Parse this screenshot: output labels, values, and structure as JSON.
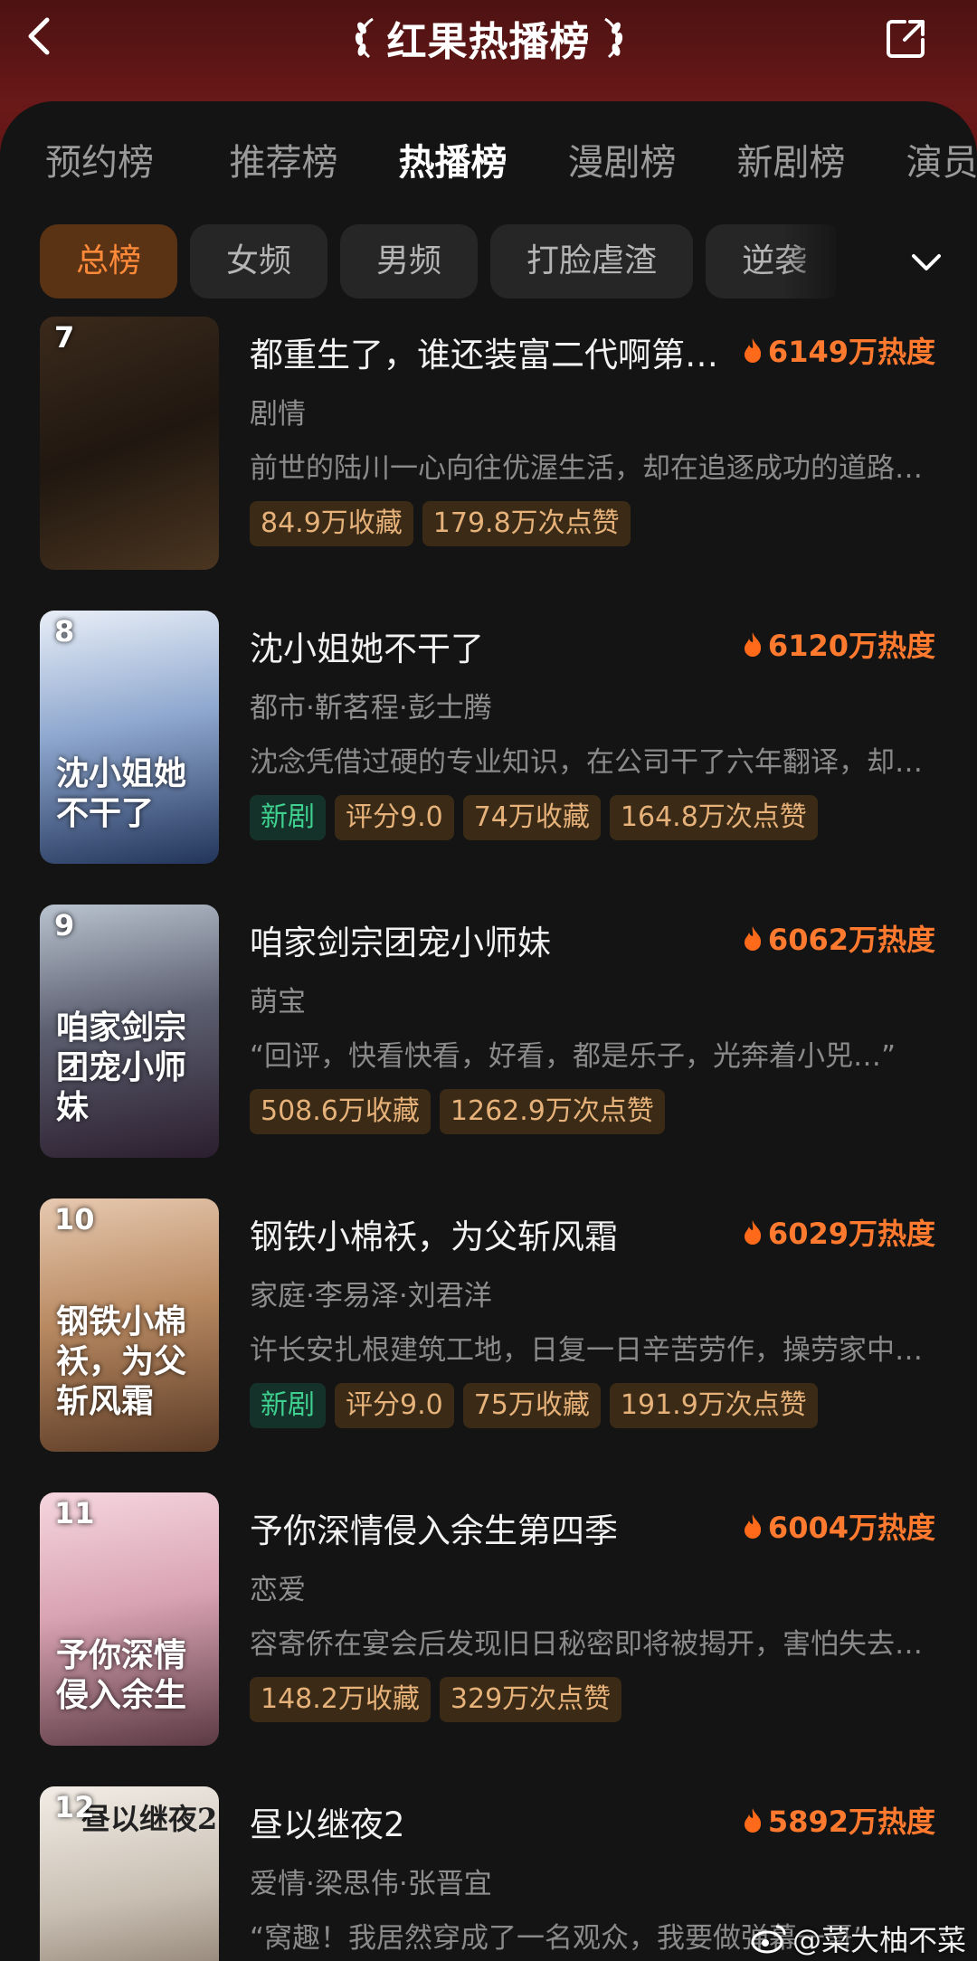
{
  "header": {
    "title": "红果热播榜"
  },
  "main_tabs": [
    {
      "label": "预约榜"
    },
    {
      "label": "推荐榜"
    },
    {
      "label": "热播榜",
      "active": true
    },
    {
      "label": "漫剧榜"
    },
    {
      "label": "新剧榜"
    },
    {
      "label": "演员榜"
    }
  ],
  "sub_tabs": [
    {
      "label": "总榜",
      "active": true
    },
    {
      "label": "女频"
    },
    {
      "label": "男频"
    },
    {
      "label": "打脸虐渣"
    },
    {
      "label": "逆袭"
    }
  ],
  "items": [
    {
      "rank": "7",
      "title": "都重生了，谁还装富二代啊第三季",
      "heat": "6149万热度",
      "meta": "剧情",
      "desc": "前世的陆川一心向往优渥生活，却在追逐成功的道路上迷失了自我",
      "tags": [
        {
          "text": "84.9万收藏"
        },
        {
          "text": "179.8万次点赞"
        }
      ],
      "cover_text": ""
    },
    {
      "rank": "8",
      "title": "沈小姐她不干了",
      "heat": "6120万热度",
      "meta": "都市·靳茗程·彭士腾",
      "desc": "沈念凭借过硬的专业知识，在公司干了六年翻译，却被上司抢走功劳",
      "tags": [
        {
          "text": "新剧",
          "green": true
        },
        {
          "text": "评分9.0"
        },
        {
          "text": "74万收藏"
        },
        {
          "text": "164.8万次点赞"
        }
      ],
      "cover_text": "沈小姐她不干了"
    },
    {
      "rank": "9",
      "title": "咱家剑宗团宠小师妹",
      "heat": "6062万热度",
      "meta": "萌宝",
      "desc": "“回评，快看快看，好看，都是乐子，光奔着小兕…”",
      "tags": [
        {
          "text": "508.6万收藏"
        },
        {
          "text": "1262.9万次点赞"
        }
      ],
      "cover_text": "咱家剑宗团宠小师妹"
    },
    {
      "rank": "10",
      "title": "钢铁小棉袄，为父斩风霜",
      "heat": "6029万热度",
      "meta": "家庭·李易泽·刘君洋",
      "desc": "许长安扎根建筑工地，日复一日辛苦劳作，操劳家中大小事务",
      "tags": [
        {
          "text": "新剧",
          "green": true
        },
        {
          "text": "评分9.0"
        },
        {
          "text": "75万收藏"
        },
        {
          "text": "191.9万次点赞"
        }
      ],
      "cover_text": "钢铁小棉袄，为父斩风霜"
    },
    {
      "rank": "11",
      "title": "予你深情侵入余生第四季",
      "heat": "6004万热度",
      "meta": "恋爱",
      "desc": "容寄侨在宴会后发现旧日秘密即将被揭开，害怕失去一切",
      "tags": [
        {
          "text": "148.2万收藏"
        },
        {
          "text": "329万次点赞"
        }
      ],
      "cover_text": "予你深情侵入余生"
    },
    {
      "rank": "12",
      "title": "昼以继夜2",
      "heat": "5892万热度",
      "meta": "爱情·梁思伟·张晋宜",
      "desc": "“窝趣！我居然穿成了一名观众，我要做弹幕一哥”",
      "tags": [],
      "cover_text": "昼以继夜2"
    }
  ],
  "watermark": "@菜大柚不菜",
  "colors": {
    "accent": "#ff7a2e",
    "header_red": "#6a1818",
    "background": "#141414",
    "chip_active_bg": "#5a3315",
    "tag_bg": "#3a2a16",
    "tag_text": "#e6b27a",
    "new_tag_text": "#3fd08f"
  },
  "icons": {
    "back": "chevron-left-icon",
    "share": "share-icon",
    "expand": "chevron-down-icon",
    "heat": "flame-icon",
    "watermark": "weibo-icon"
  }
}
